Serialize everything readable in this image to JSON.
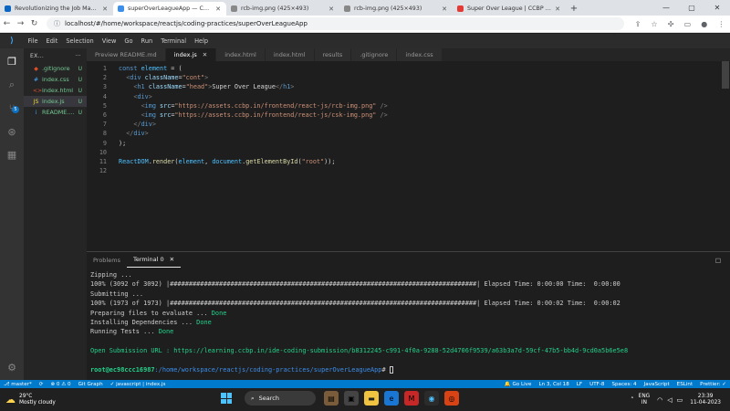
{
  "browser": {
    "tabs": [
      {
        "title": "Revolutionizing the Job Market | N",
        "fav": "#0a66c2"
      },
      {
        "title": "superOverLeagueApp — CCBP ID",
        "fav": "#3b8eea",
        "active": true
      },
      {
        "title": "rcb-img.png (425×493)",
        "fav": "#888"
      },
      {
        "title": "rcb-img.png (425×493)",
        "fav": "#888"
      },
      {
        "title": "Super Over League | CCBP React",
        "fav": "#e53935"
      }
    ],
    "new_tab": "+",
    "url": "localhost/#/home/workspace/reactjs/coding-practices/superOverLeagueApp"
  },
  "menu": [
    "File",
    "Edit",
    "Selection",
    "View",
    "Go",
    "Run",
    "Terminal",
    "Help"
  ],
  "explorer": {
    "title": "EX...",
    "files": [
      {
        "icon": "◆",
        "name": ".gitignore",
        "status": "U",
        "color": "#e44d26"
      },
      {
        "icon": "#",
        "name": "index.css",
        "status": "U",
        "color": "#42a5f5"
      },
      {
        "icon": "<>",
        "name": "index.html",
        "status": "U",
        "color": "#e44d26"
      },
      {
        "icon": "JS",
        "name": "index.js",
        "status": "U",
        "color": "#f1dd35",
        "sel": true
      },
      {
        "icon": "i",
        "name": "README....",
        "status": "U",
        "color": "#42a5f5"
      }
    ]
  },
  "editor_tabs": [
    {
      "label": "Preview README.md"
    },
    {
      "label": "index.js",
      "active": true
    },
    {
      "label": "index.html"
    },
    {
      "label": "index.html"
    },
    {
      "label": "results"
    },
    {
      "label": ".gitignore"
    },
    {
      "label": "index.css"
    }
  ],
  "code": [
    {
      "n": "1",
      "h": "<span class='kw'>const</span> <span class='var'>element</span> = ("
    },
    {
      "n": "2",
      "h": "  <span class='pun'>&lt;</span><span class='tag'>div</span> <span class='att'>className</span>=<span class='str'>\"cont\"</span><span class='pun'>&gt;</span>"
    },
    {
      "n": "3",
      "h": "    <span class='pun'>&lt;</span><span class='tag'>h1</span> <span class='att'>className</span>=<span class='str'>\"head\"</span><span class='pun'>&gt;</span>Super Over League<span class='pun'>&lt;/</span><span class='tag'>h1</span><span class='pun'>&gt;</span>"
    },
    {
      "n": "4",
      "h": "    <span class='pun'>&lt;</span><span class='tag'>div</span><span class='pun'>&gt;</span>"
    },
    {
      "n": "5",
      "h": "      <span class='pun'>&lt;</span><span class='tag'>img</span> <span class='att'>src</span>=<span class='str'>\"https://assets.ccbp.in/frontend/react-js/rcb-img.png\"</span> <span class='pun'>/&gt;</span>"
    },
    {
      "n": "6",
      "h": "      <span class='pun'>&lt;</span><span class='tag'>img</span> <span class='att'>src</span>=<span class='str'>\"https://assets.ccbp.in/frontend/react-js/csk-img.png\"</span> <span class='pun'>/&gt;</span>"
    },
    {
      "n": "7",
      "h": "    <span class='pun'>&lt;/</span><span class='tag'>div</span><span class='pun'>&gt;</span>"
    },
    {
      "n": "8",
      "h": "  <span class='pun'>&lt;/</span><span class='tag'>div</span><span class='pun'>&gt;</span>"
    },
    {
      "n": "9",
      "h": ");"
    },
    {
      "n": "10",
      "h": ""
    },
    {
      "n": "11",
      "h": "<span class='var'>ReactDOM</span>.<span class='fn'>render</span>(<span class='var'>element</span>, <span class='var'>document</span>.<span class='fn'>getElementById</span>(<span class='str'>\"root\"</span>));"
    },
    {
      "n": "12",
      "h": ""
    }
  ],
  "panel": {
    "tabs": [
      "Problems",
      "Terminal 0"
    ],
    "right": "□"
  },
  "terminal": [
    {
      "t": "Zipping ...",
      "c": ""
    },
    {
      "t": "100% (3092 of 3092) |#################################################################################| Elapsed Time: 0:00:00 Time:  0:00:00",
      "c": ""
    },
    {
      "t": "Submitting ...",
      "c": ""
    },
    {
      "t": "100% (1973 of 1973) |#################################################################################| Elapsed Time: 0:00:02 Time:  0:00:02",
      "c": ""
    },
    {
      "t": "Preparing files to evaluate ... ",
      "d": "Done"
    },
    {
      "t": "Installing Dependencies ... ",
      "d": "Done"
    },
    {
      "t": "Running Tests ... ",
      "d": "Done"
    },
    {
      "t": "",
      "c": ""
    },
    {
      "t": "Open Submission URL : https://learning.ccbp.in/ide-coding-submission/b8312245-c991-4f0a-9288-52d4706f9539/a63b3a7d-59cf-47b5-bb4d-9cd0a5b6e5e8",
      "c": "grn"
    },
    {
      "t": "",
      "c": ""
    }
  ],
  "prompt": {
    "user": "root@ec98ccc16987",
    "path": ":/home/workspace/reactjs/coding-practices/superOverLeagueApp",
    "sym": "# "
  },
  "status": {
    "left": [
      "⎇ master*",
      "⟳",
      "⊗ 0 ⚠ 0",
      "Git Graph",
      "✓ javascript | index.js"
    ],
    "right": [
      "🔔 Go Live",
      "Ln 3, Col 18",
      "LF",
      "UTF-8",
      "Spaces: 4",
      "JavaScript",
      "ESLint",
      "Prettier: ✓"
    ]
  },
  "taskbar": {
    "temp": "29°C",
    "weather": "Mostly cloudy",
    "search": "Search",
    "lang1": "ENG",
    "lang2": "IN",
    "time": "23:39",
    "date": "11-04-2023"
  }
}
